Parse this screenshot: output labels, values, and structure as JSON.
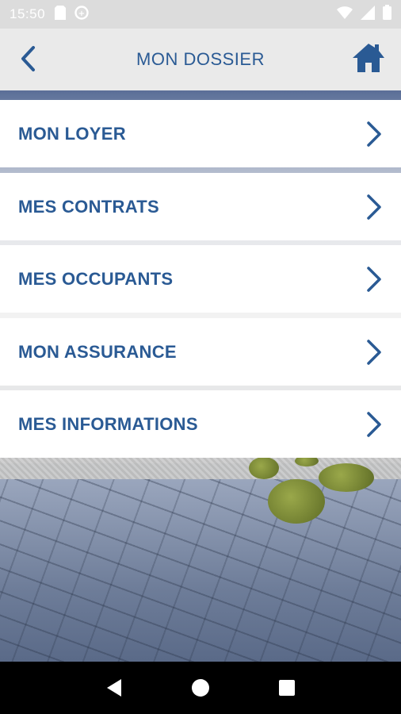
{
  "status_bar": {
    "time": "15:50",
    "icons": [
      "sim-card-icon",
      "data-saver-icon",
      "wifi-icon",
      "signal-icon",
      "battery-icon"
    ]
  },
  "app_bar": {
    "title": "MON DOSSIER",
    "back_icon": "chevron-left-icon",
    "home_icon": "home-icon"
  },
  "menu": {
    "items": [
      {
        "label": "MON LOYER"
      },
      {
        "label": "MES CONTRATS"
      },
      {
        "label": "MES OCCUPANTS"
      },
      {
        "label": "MON ASSURANCE"
      },
      {
        "label": "MES INFORMATIONS"
      }
    ]
  },
  "nav_bar": {
    "icons": [
      "back-triangle-icon",
      "home-circle-icon",
      "recents-square-icon"
    ]
  },
  "colors": {
    "accent": "#2a5a94",
    "status_bar_bg": "#dcdcdc",
    "app_bar_bg": "#eaeaea",
    "nav_bar_bg": "#000000"
  }
}
